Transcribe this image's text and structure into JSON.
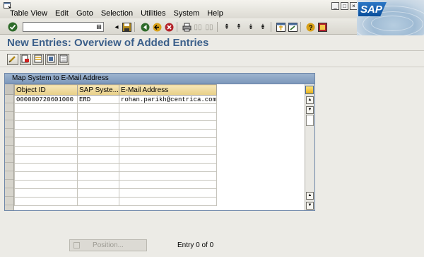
{
  "menu": [
    "Table View",
    "Edit",
    "Goto",
    "Selection",
    "Utilities",
    "System",
    "Help"
  ],
  "window_controls": [
    "_",
    "□",
    "×"
  ],
  "logo_text": "SAP",
  "command_field": {
    "value": ""
  },
  "page_title": "New Entries: Overview of Added Entries",
  "table": {
    "title": "Map System to E-Mail Address",
    "columns": [
      "Object ID",
      "SAP Syste...",
      "E-Mail Address"
    ],
    "rows": [
      [
        "000000720601000",
        "ERD",
        "rohan.parikh@centrica.com"
      ],
      [
        "",
        "",
        ""
      ],
      [
        "",
        "",
        ""
      ],
      [
        "",
        "",
        ""
      ],
      [
        "",
        "",
        ""
      ],
      [
        "",
        "",
        ""
      ],
      [
        "",
        "",
        ""
      ],
      [
        "",
        "",
        ""
      ],
      [
        "",
        "",
        ""
      ],
      [
        "",
        "",
        ""
      ],
      [
        "",
        "",
        ""
      ],
      [
        "",
        "",
        ""
      ],
      [
        "",
        "",
        ""
      ]
    ]
  },
  "position_button": "Position...",
  "entry_info": "Entry 0 of 0",
  "colors": {
    "title": "#3b5f8a",
    "table_header": "#e8cf86",
    "tc_title": "#7d98bb"
  }
}
